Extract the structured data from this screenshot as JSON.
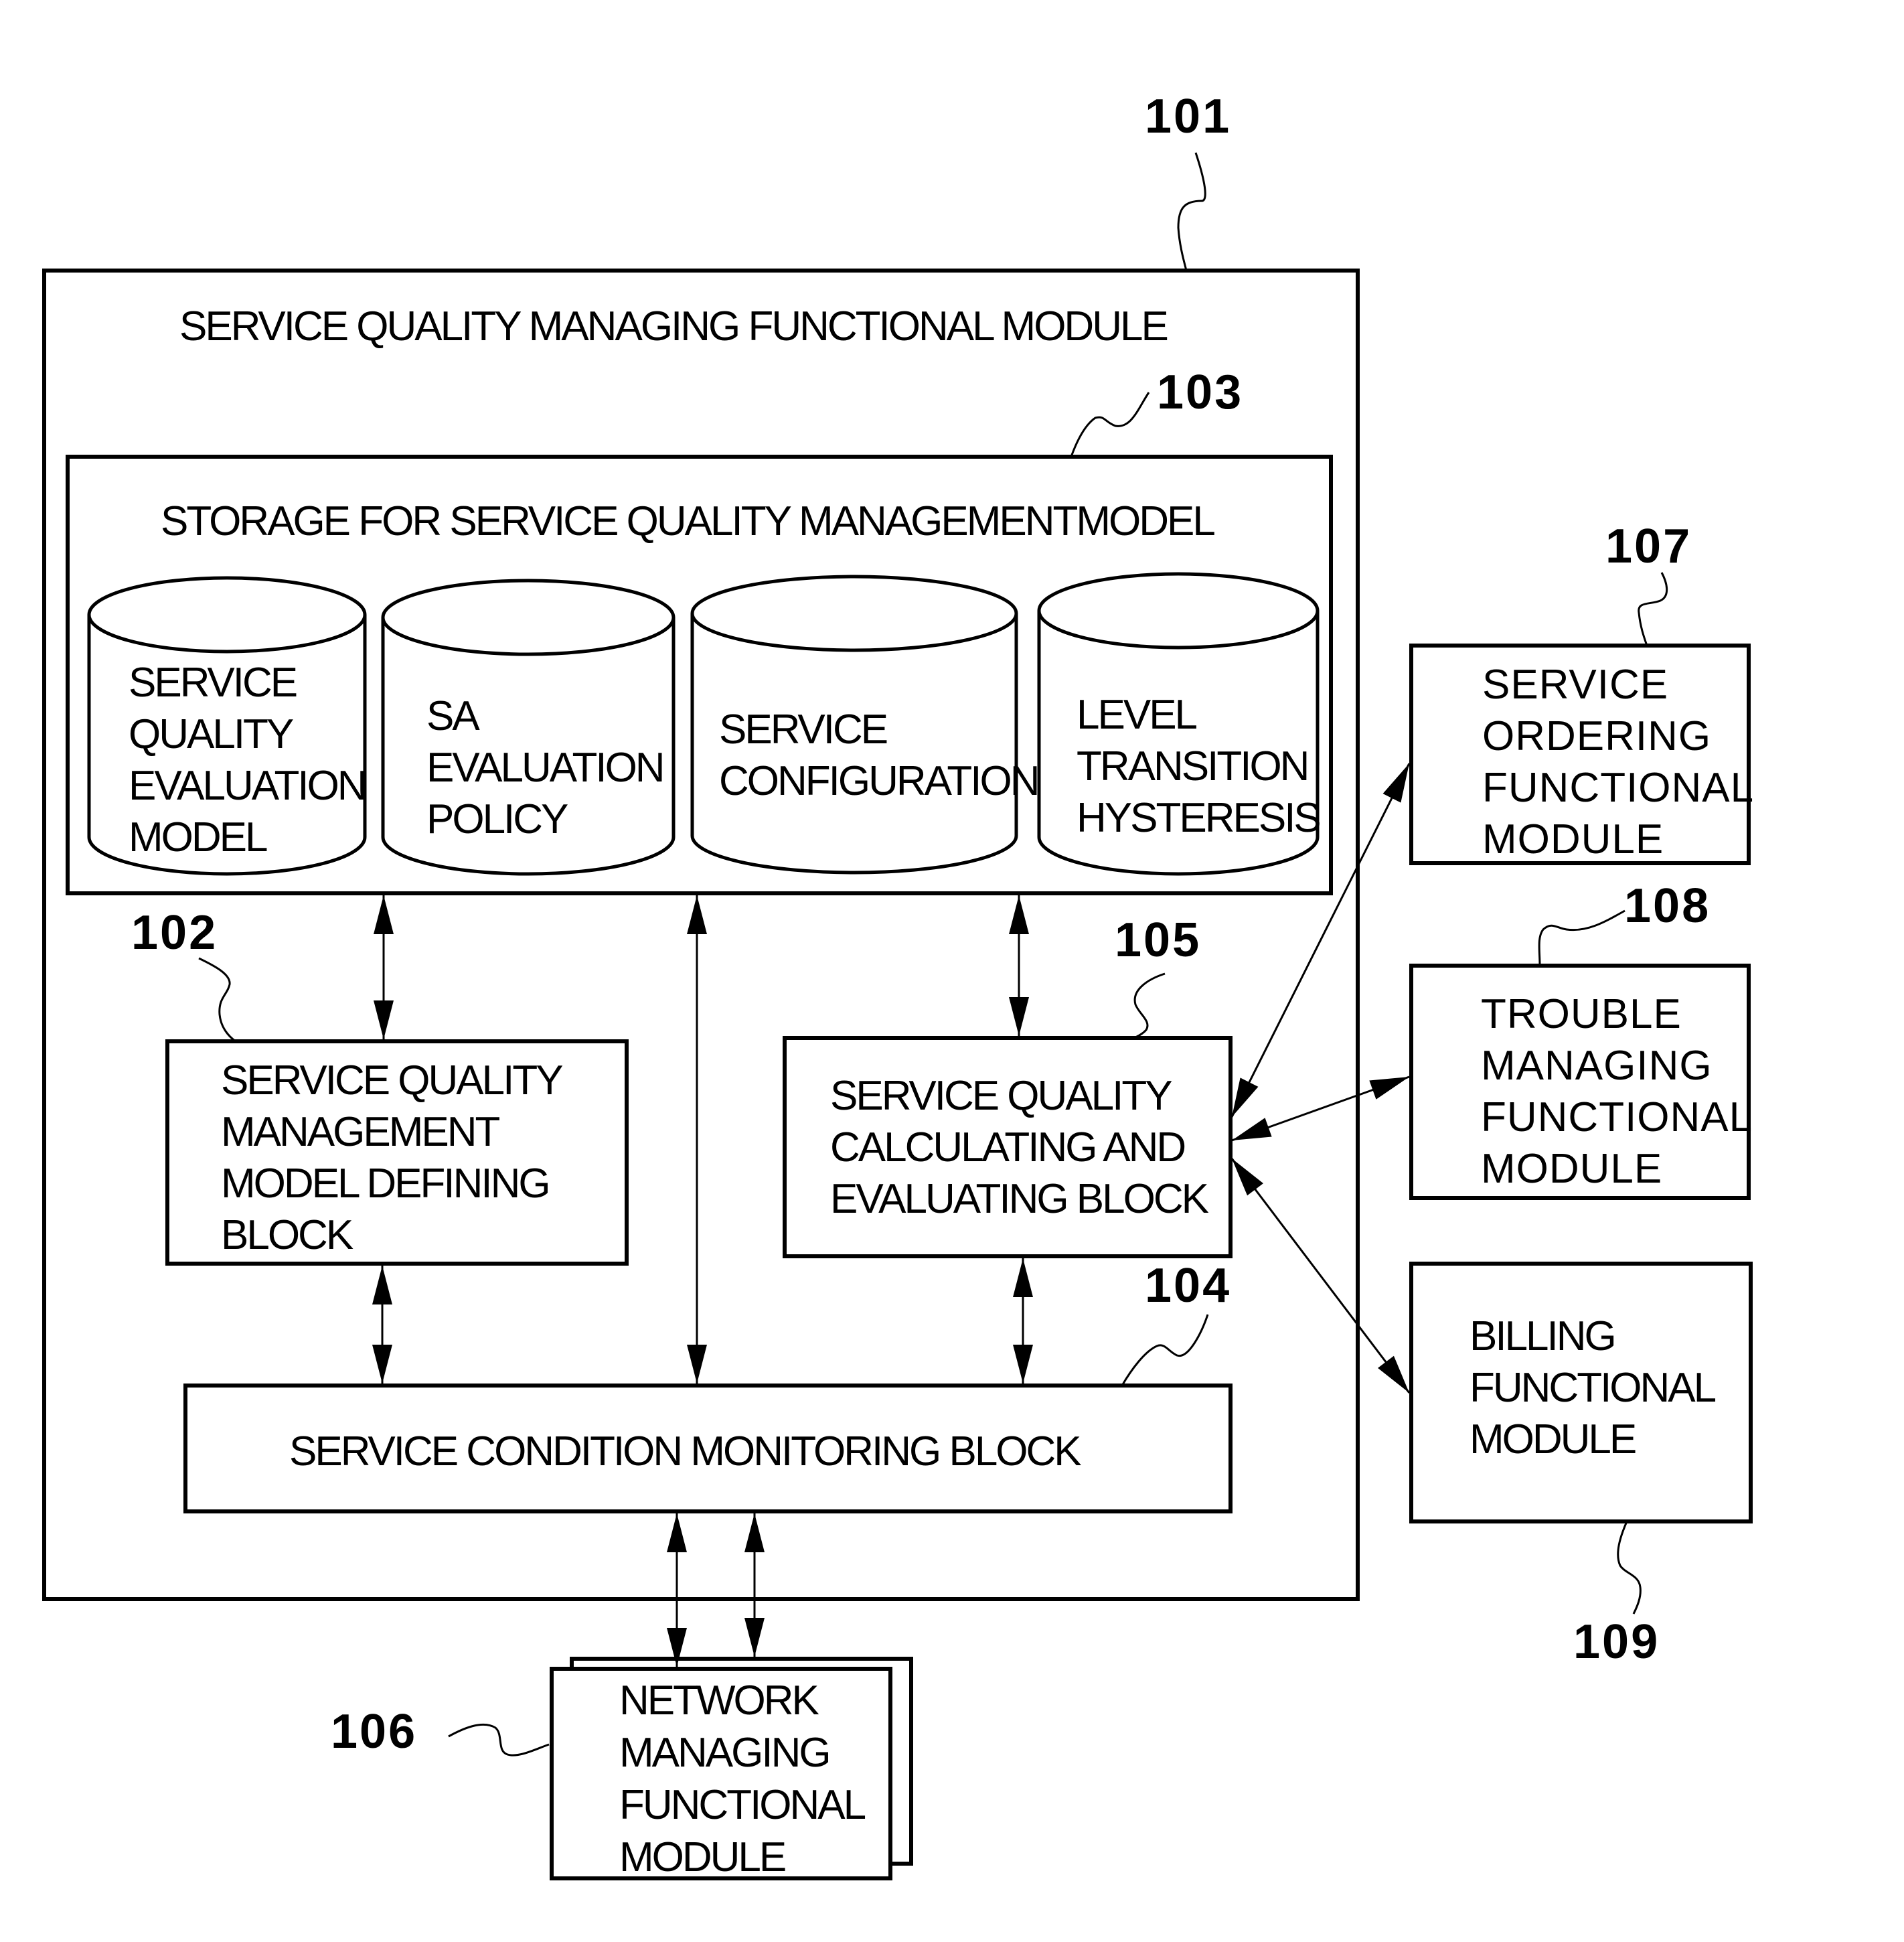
{
  "figure": {
    "outer_module": {
      "ref": "101",
      "title": "SERVICE QUALITY MANAGING FUNCTIONAL MODULE"
    },
    "storage": {
      "ref": "103",
      "title": "STORAGE FOR SERVICE QUALITY MANAGEMENTMODEL",
      "databases": [
        {
          "lines": [
            "SERVICE",
            "QUALITY",
            "EVALUATION",
            "MODEL"
          ]
        },
        {
          "lines": [
            "SA",
            "EVALUATION",
            "POLICY"
          ]
        },
        {
          "lines": [
            "SERVICE",
            "CONFIGURATION"
          ]
        },
        {
          "lines": [
            "LEVEL",
            "TRANSITION",
            "HYSTERESIS"
          ]
        }
      ]
    },
    "model_defining_block": {
      "ref": "102",
      "lines": [
        "SERVICE QUALITY",
        "MANAGEMENT",
        "MODEL DEFINING",
        "BLOCK"
      ]
    },
    "calculating_block": {
      "ref": "105",
      "lines": [
        "SERVICE QUALITY",
        "CALCULATING AND",
        "EVALUATING BLOCK"
      ]
    },
    "monitoring_block": {
      "ref": "104",
      "label": "SERVICE CONDITION MONITORING BLOCK"
    },
    "network_module": {
      "ref": "106",
      "lines": [
        "NETWORK",
        "MANAGING",
        "FUNCTIONAL",
        "MODULE"
      ]
    },
    "ordering_module": {
      "ref": "107",
      "lines": [
        "SERVICE",
        "ORDERING",
        "FUNCTIONAL",
        "MODULE"
      ]
    },
    "trouble_module": {
      "ref": "108",
      "lines": [
        "TROUBLE",
        "MANAGING",
        "FUNCTIONAL",
        "MODULE"
      ]
    },
    "billing_module": {
      "ref": "109",
      "lines": [
        "BILLING",
        "FUNCTIONAL",
        "MODULE"
      ]
    }
  }
}
